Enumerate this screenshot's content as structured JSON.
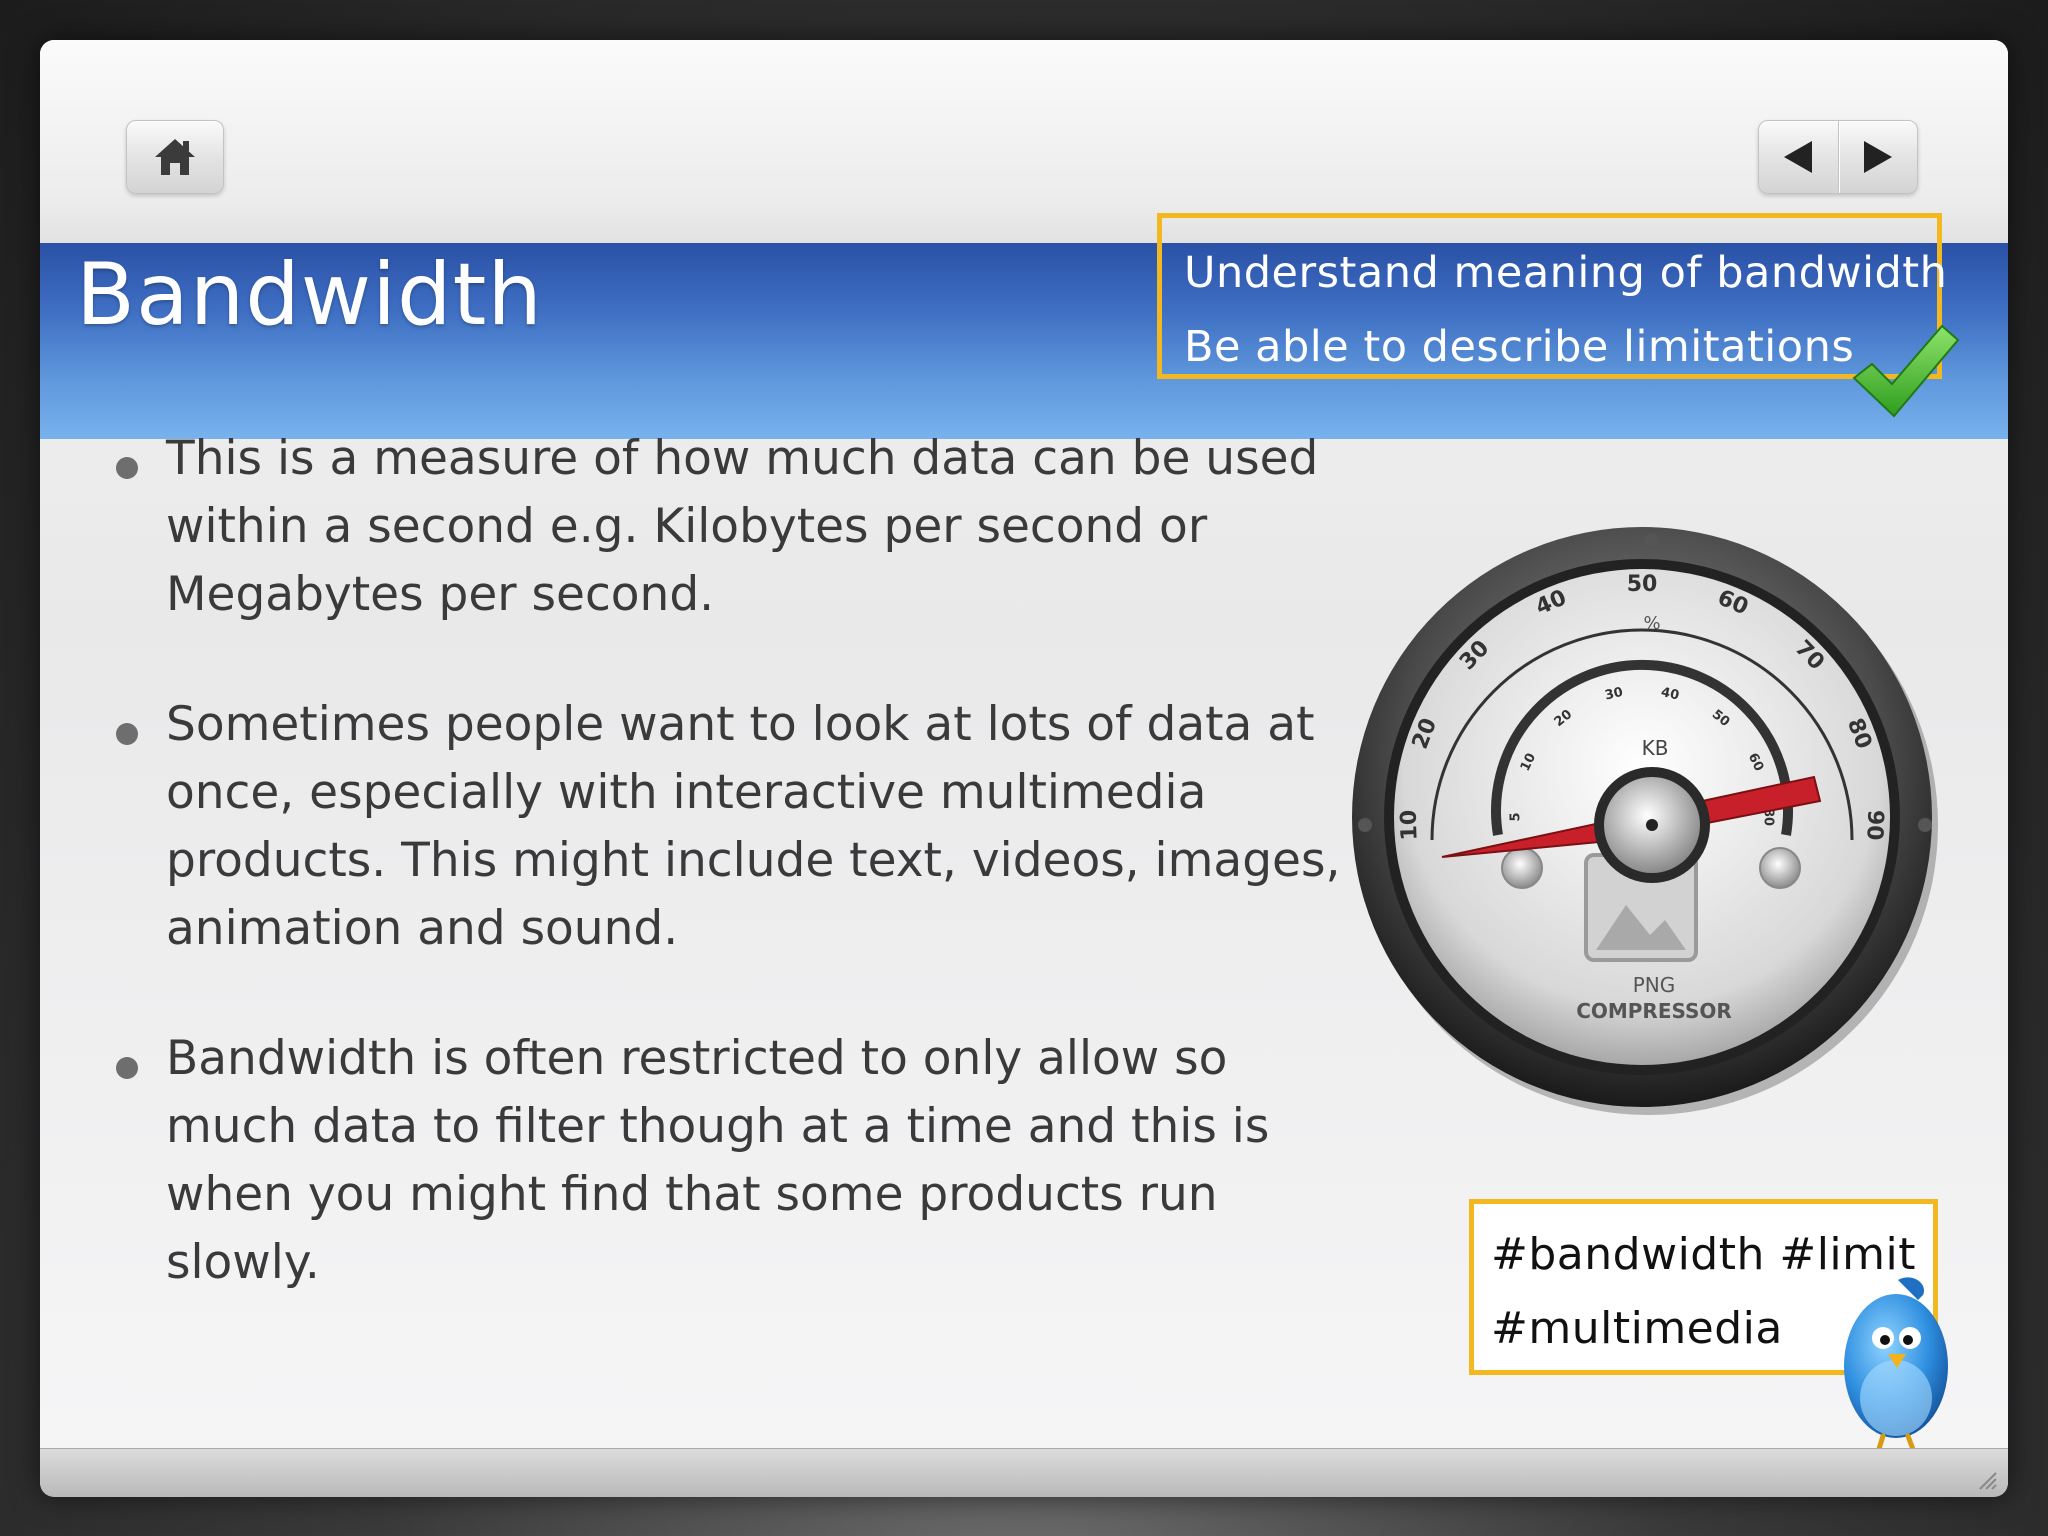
{
  "nav": {
    "home_icon": "home-icon",
    "prev_icon": "triangle-left-icon",
    "next_icon": "triangle-right-icon"
  },
  "slide": {
    "title": "Bandwidth",
    "objectives": [
      "Understand meaning of bandwidth",
      "Be able to describe limitations"
    ],
    "bullets": [
      "This is a measure of how much data can be used within a second e.g. Kilobytes per second or Megabytes per second.",
      "Sometimes people want to look at lots of data at once, especially with interactive multimedia products. This might include text, videos, images, animation and sound.",
      "Bandwidth is often restricted to only allow so much data to filter though at a time and this is when you might find that some products run slowly."
    ],
    "hashtags": [
      "#bandwidth   #limit",
      "#multimedia"
    ]
  },
  "gauge": {
    "outer_ticks": [
      "10",
      "20",
      "30",
      "40",
      "50",
      "60",
      "70",
      "80",
      "90"
    ],
    "outer_unit": "%",
    "inner_ticks": [
      "5",
      "10",
      "20",
      "30",
      "40",
      "50",
      "60",
      "80"
    ],
    "inner_unit": "KB",
    "label_line1": "PNG",
    "label_line2": "COMPRESSOR"
  },
  "colors": {
    "accent_border": "#f3b81f",
    "title_band_top": "#2a51a6",
    "title_band_bottom": "#78b2ee",
    "needle": "#c8202a",
    "check": "#3cbf28"
  }
}
